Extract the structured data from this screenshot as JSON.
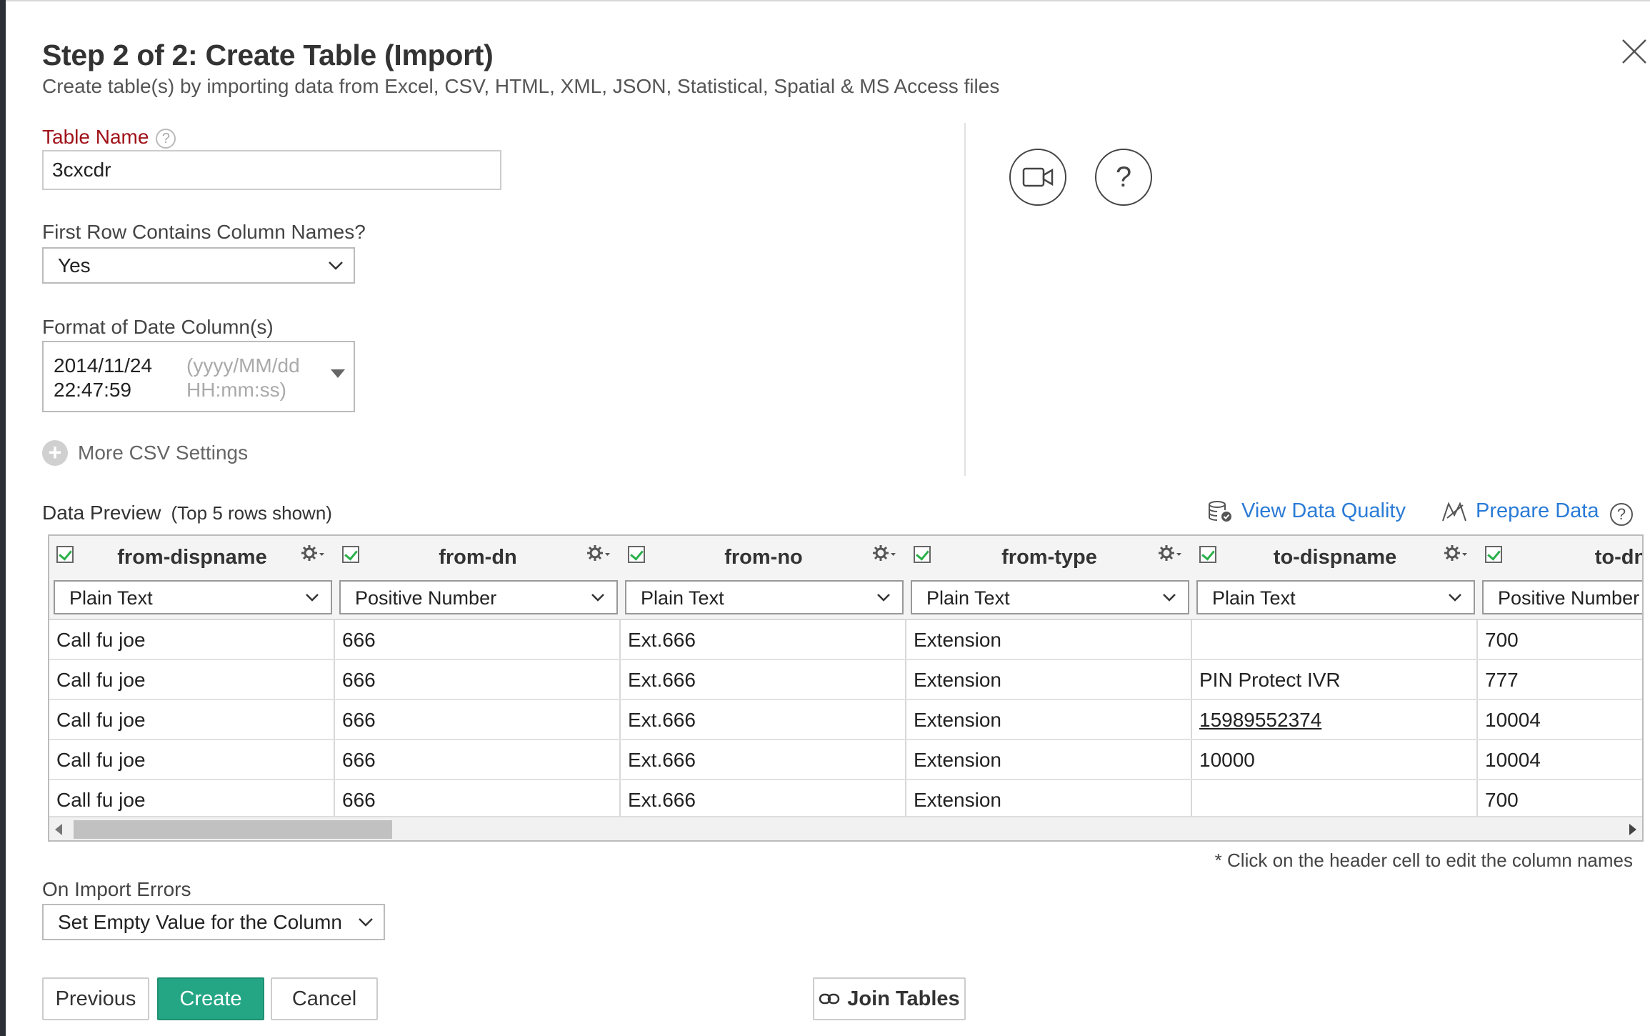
{
  "header": {
    "title": "Step 2 of 2: Create Table (Import)",
    "subtitle": "Create table(s) by importing data from Excel, CSV, HTML, XML, JSON, Statistical, Spatial & MS Access files"
  },
  "form": {
    "table_name_label": "Table Name",
    "table_name_value": "3cxcdr",
    "first_row_label": "First Row Contains Column Names?",
    "first_row_value": "Yes",
    "date_format_label": "Format of Date Column(s)",
    "date_value_line1": "2014/11/24",
    "date_value_line2": "22:47:59",
    "date_format_line1": "(yyyy/MM/dd",
    "date_format_line2": "HH:mm:ss)",
    "more_csv_label": "More CSV Settings"
  },
  "preview": {
    "title": "Data Preview",
    "subtitle": "(Top 5 rows shown)",
    "view_quality_label": "View Data Quality",
    "prepare_label": "Prepare Data",
    "note": "* Click on the header cell to edit the column names",
    "columns": [
      {
        "name": "from-dispname",
        "type": "Plain Text",
        "cells": [
          "Call fu joe",
          "Call fu joe",
          "Call fu joe",
          "Call fu joe",
          "Call fu joe"
        ]
      },
      {
        "name": "from-dn",
        "type": "Positive Number",
        "cells": [
          "666",
          "666",
          "666",
          "666",
          "666"
        ]
      },
      {
        "name": "from-no",
        "type": "Plain Text",
        "cells": [
          "Ext.666",
          "Ext.666",
          "Ext.666",
          "Ext.666",
          "Ext.666"
        ]
      },
      {
        "name": "from-type",
        "type": "Plain Text",
        "cells": [
          "Extension",
          "Extension",
          "Extension",
          "Extension",
          "Extension"
        ]
      },
      {
        "name": "to-dispname",
        "type": "Plain Text",
        "cells": [
          "",
          "PIN Protect IVR",
          "15989552374",
          "10000",
          ""
        ]
      },
      {
        "name": "to-dn",
        "type": "Positive Number",
        "cells": [
          "700",
          "777",
          "10004",
          "10004",
          "700"
        ]
      }
    ]
  },
  "import_errors": {
    "label": "On Import Errors",
    "value": "Set Empty Value for the Column"
  },
  "buttons": {
    "previous": "Previous",
    "create": "Create",
    "cancel": "Cancel",
    "join": "Join Tables"
  }
}
